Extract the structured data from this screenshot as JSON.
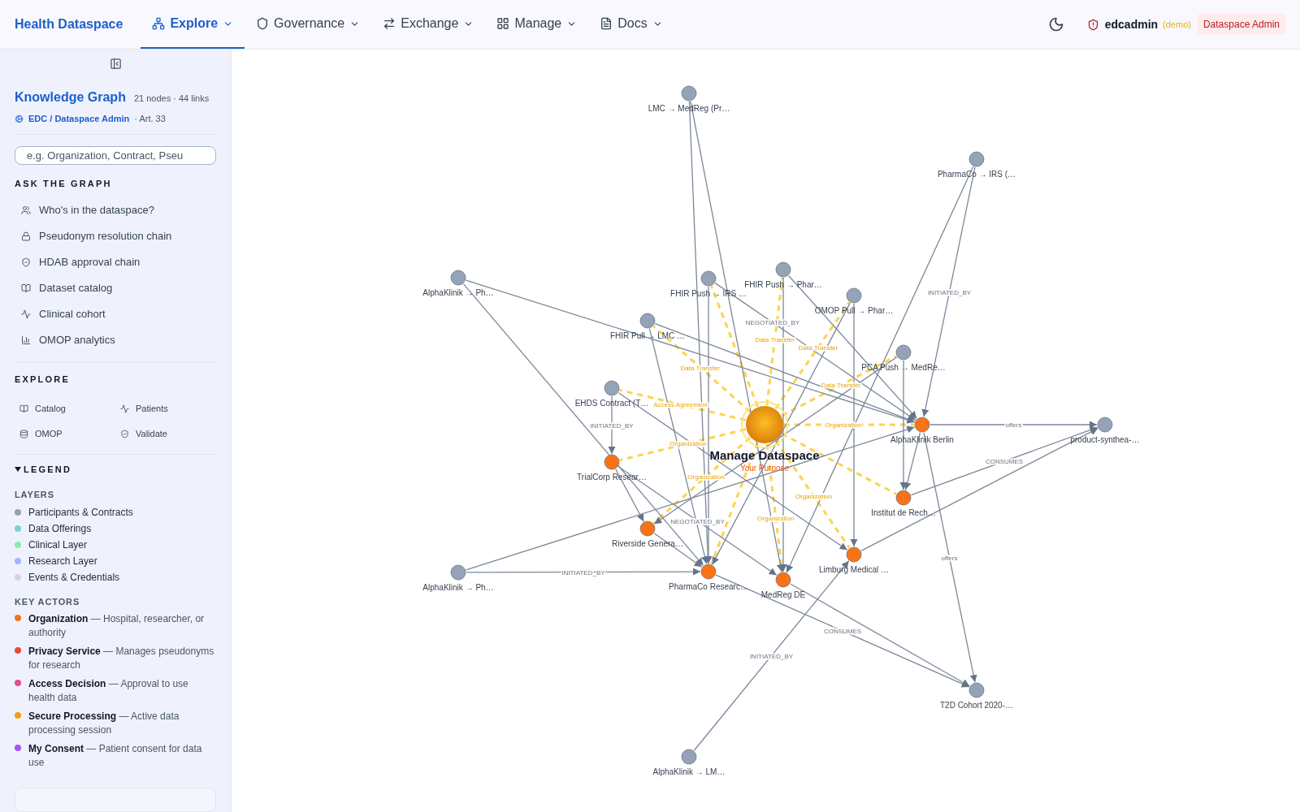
{
  "nav": {
    "brand": "Health Dataspace",
    "tabs": [
      {
        "label": "Explore",
        "selected": true
      },
      {
        "label": "Governance",
        "selected": false
      },
      {
        "label": "Exchange",
        "selected": false
      },
      {
        "label": "Manage",
        "selected": false
      },
      {
        "label": "Docs",
        "selected": false
      }
    ],
    "user": {
      "name": "edcadmin",
      "tag": "(demo)",
      "role": "Dataspace Admin"
    }
  },
  "sidebar": {
    "title": "Knowledge Graph",
    "stats": "21 nodes · 44 links",
    "context": "EDC / Dataspace Admin",
    "article": "· Art. 33",
    "search": {
      "placeholder": "e.g. Organization, Contract, Pseu"
    },
    "ask_heading": "ASK THE GRAPH",
    "ask_items": [
      {
        "label": "Who's in the dataspace?"
      },
      {
        "label": "Pseudonym resolution chain"
      },
      {
        "label": "HDAB approval chain"
      },
      {
        "label": "Dataset catalog"
      },
      {
        "label": "Clinical cohort"
      },
      {
        "label": "OMOP analytics"
      }
    ],
    "explore_heading": "EXPLORE",
    "explore_items": [
      {
        "label": "Catalog"
      },
      {
        "label": "Patients"
      },
      {
        "label": "OMOP"
      },
      {
        "label": "Validate"
      }
    ],
    "legend": {
      "heading": "LEGEND",
      "expanded": true,
      "layers_heading": "LAYERS",
      "layers": [
        {
          "label": "Participants & Contracts",
          "color": "#94a3b8"
        },
        {
          "label": "Data Offerings",
          "color": "#7dd3c8"
        },
        {
          "label": "Clinical Layer",
          "color": "#86efac"
        },
        {
          "label": "Research Layer",
          "color": "#a5b4fc"
        },
        {
          "label": "Events & Credentials",
          "color": "#d4d4d8"
        }
      ],
      "actors_heading": "KEY ACTORS",
      "actors": [
        {
          "name": "Organization",
          "desc": "— Hospital, researcher, or authority",
          "color": "#f97316"
        },
        {
          "name": "Privacy Service",
          "desc": "— Manages pseudonyms for research",
          "color": "#ef4444"
        },
        {
          "name": "Access Decision",
          "desc": "— Approval to use health data",
          "color": "#ec4899"
        },
        {
          "name": "Secure Processing",
          "desc": "— Active data processing session",
          "color": "#f59e0b"
        },
        {
          "name": "My Consent",
          "desc": "— Patient consent for data use",
          "color": "#a855f7"
        }
      ]
    }
  },
  "graph": {
    "nodes": [
      {
        "label": "LMC → MedReg (Pr…",
        "kind": "contract"
      },
      {
        "label": "PharmaCo → IRS (…",
        "kind": "contract"
      },
      {
        "label": "AlphaKlinik → Ph…",
        "kind": "contract"
      },
      {
        "label": "FHIR Push → IRS …",
        "kind": "contract"
      },
      {
        "label": "FHIR Push → Phar…",
        "kind": "contract"
      },
      {
        "label": "OMOP Pull → Phar…",
        "kind": "contract"
      },
      {
        "label": "FHIR Pull → LMC …",
        "kind": "contract"
      },
      {
        "label": "PCA Push → MedRe…",
        "kind": "contract"
      },
      {
        "label": "EHDS Contract (T…",
        "kind": "contract"
      },
      {
        "label": "AlphaKlinik Berlin",
        "kind": "organization"
      },
      {
        "label": "product-synthea-…",
        "kind": "contract"
      },
      {
        "label": "TrialCorp Resear…",
        "kind": "organization"
      },
      {
        "label": "Institut de Rech…",
        "kind": "organization"
      },
      {
        "label": "Riverside Genera…",
        "kind": "organization"
      },
      {
        "label": "Limburg Medical …",
        "kind": "organization"
      },
      {
        "label": "AlphaKlinik → Ph…",
        "kind": "contract"
      },
      {
        "label": "PharmaCo Researc…",
        "kind": "organization"
      },
      {
        "label": "MedReg DE",
        "kind": "organization"
      },
      {
        "label": "T2D Cohort 2020-…",
        "kind": "contract"
      },
      {
        "label": "AlphaKlinik → LM…",
        "kind": "contract"
      },
      {
        "label": "Manage Dataspace",
        "sublabel": "Your Purpose",
        "kind": "purpose"
      }
    ],
    "links": [
      {
        "kind": "purpose"
      },
      {
        "kind": "purpose",
        "label": "Data Transfer"
      },
      {
        "kind": "purpose",
        "label": "Data Transfer"
      },
      {
        "kind": "purpose",
        "label": "Data Transfer"
      },
      {
        "kind": "purpose",
        "label": "Data Transfer"
      },
      {
        "kind": "purpose",
        "label": "Access Agreement"
      },
      {
        "kind": "purpose",
        "label": "Organization"
      },
      {
        "kind": "purpose",
        "label": "Organization"
      },
      {
        "kind": "purpose"
      },
      {
        "kind": "purpose",
        "label": "Organization"
      },
      {
        "kind": "purpose",
        "label": "Organization"
      },
      {
        "kind": "purpose"
      },
      {
        "kind": "purpose",
        "label": "Organization"
      },
      {
        "kind": "relation"
      },
      {
        "kind": "relation"
      },
      {
        "kind": "relation"
      },
      {
        "kind": "relation",
        "label": "INITIATED_BY"
      },
      {
        "kind": "relation"
      },
      {
        "kind": "relation"
      },
      {
        "kind": "relation",
        "label": "NEGOTIATED_BY"
      },
      {
        "kind": "relation"
      },
      {
        "kind": "relation"
      },
      {
        "kind": "relation"
      },
      {
        "kind": "relation"
      },
      {
        "kind": "relation"
      },
      {
        "kind": "relation"
      },
      {
        "kind": "relation"
      },
      {
        "kind": "relation"
      },
      {
        "kind": "relation"
      },
      {
        "kind": "relation",
        "label": "INITIATED_BY"
      },
      {
        "kind": "relation"
      },
      {
        "kind": "relation",
        "label": "offers"
      },
      {
        "kind": "relation"
      },
      {
        "kind": "relation",
        "label": "offers"
      },
      {
        "kind": "relation"
      },
      {
        "kind": "relation",
        "label": "NEGOTIATED_BY"
      },
      {
        "kind": "relation",
        "label": "CONSUMES"
      },
      {
        "kind": "relation"
      },
      {
        "kind": "relation"
      },
      {
        "kind": "relation",
        "label": "INITIATED_BY"
      },
      {
        "kind": "relation"
      },
      {
        "kind": "relation",
        "label": "CONSUMES"
      },
      {
        "kind": "relation"
      },
      {
        "kind": "relation",
        "label": "INITIATED_BY"
      }
    ]
  }
}
